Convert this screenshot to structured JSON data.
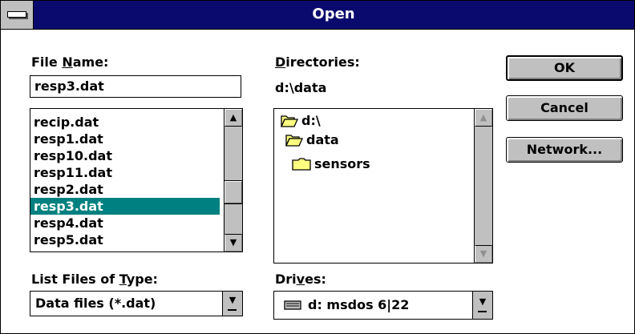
{
  "window": {
    "title": "Open"
  },
  "file_name": {
    "label_pre": "File ",
    "label_key": "N",
    "label_post": "ame:",
    "value": "resp3.dat"
  },
  "files": {
    "items": [
      "recip.dat",
      "resp1.dat",
      "resp10.dat",
      "resp11.dat",
      "resp2.dat",
      "resp3.dat",
      "resp4.dat",
      "resp5.dat"
    ],
    "selected": "resp3.dat"
  },
  "directories": {
    "label_key": "D",
    "label_post": "irectories:",
    "current_path": "d:\\data",
    "items": [
      {
        "name": "d:\\",
        "icon": "open-folder-icon"
      },
      {
        "name": "data",
        "icon": "open-folder-icon"
      },
      {
        "name": "sensors",
        "icon": "folder-icon"
      }
    ]
  },
  "file_type": {
    "label_pre": "List Files of ",
    "label_key": "T",
    "label_post": "ype:",
    "value": "Data files (*.dat)"
  },
  "drives": {
    "label_pre": "Dri",
    "label_key": "v",
    "label_post": "es:",
    "value": "d: msdos 6|22",
    "icon": "drive-icon"
  },
  "buttons": {
    "ok": "OK",
    "cancel": "Cancel",
    "network": "Network..."
  },
  "colors": {
    "title_bar": "#0a0a6e",
    "selection": "#008080",
    "face": "#c0c0c0"
  }
}
